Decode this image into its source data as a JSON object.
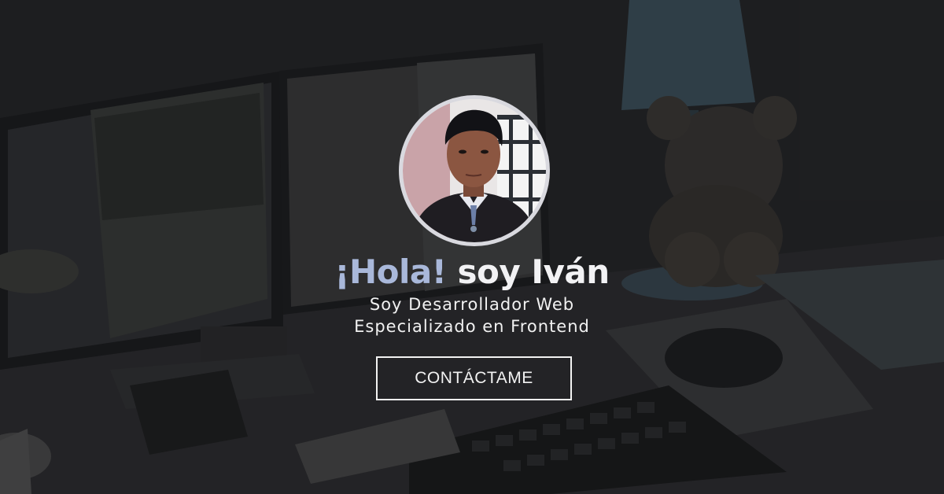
{
  "hero": {
    "greeting": "¡Hola!",
    "name": "soy Iván",
    "subtitle_line1": "Soy Desarrollador Web",
    "subtitle_line2": "Especializado en Frontend",
    "cta_label": "CONTÁCTAME"
  },
  "avatar": {
    "icon": "profile-photo"
  },
  "colors": {
    "greeting": "#a9b8da",
    "name": "#f2f2f4",
    "text": "#f1f1f1",
    "button_border": "#f2f2f2",
    "background": "#1e1f21",
    "avatar_ring": "#d9d9df"
  }
}
